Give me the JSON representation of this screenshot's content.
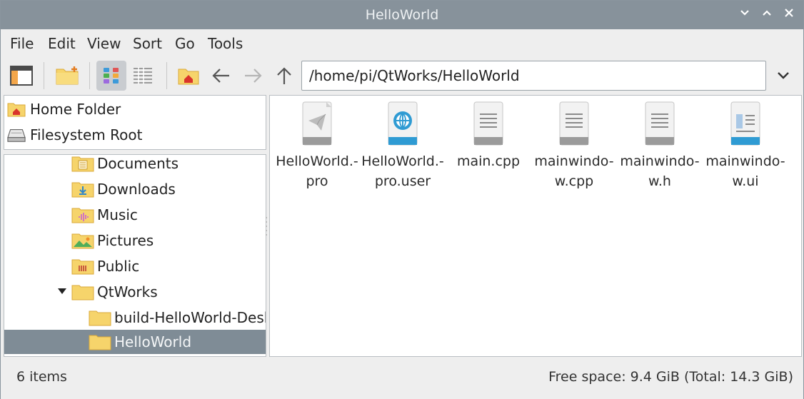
{
  "window": {
    "title": "HelloWorld"
  },
  "window_controls": {
    "minimize": "⌄",
    "maximize": "⌃",
    "close": "✕"
  },
  "menu": [
    "File",
    "Edit",
    "View",
    "Sort",
    "Go",
    "Tools"
  ],
  "toolbar": {
    "buttons": [
      "sidebar-toggle-icon",
      "new-folder-icon",
      "icon-view-icon",
      "list-view-icon",
      "home-icon",
      "back-arrow-icon",
      "forward-arrow-icon",
      "up-arrow-icon",
      "chevron-down-icon"
    ],
    "address": "/home/pi/QtWorks/HelloWorld"
  },
  "places": [
    {
      "label": "Home Folder",
      "icon": "home-folder-icon"
    },
    {
      "label": "Filesystem Root",
      "icon": "drive-icon"
    }
  ],
  "tree": [
    {
      "label": "Documents",
      "icon": "documents-folder-icon"
    },
    {
      "label": "Downloads",
      "icon": "downloads-folder-icon"
    },
    {
      "label": "Music",
      "icon": "music-folder-icon"
    },
    {
      "label": "Pictures",
      "icon": "pictures-folder-icon"
    },
    {
      "label": "Public",
      "icon": "public-folder-icon"
    },
    {
      "label": "QtWorks",
      "icon": "folder-icon",
      "expanded": true
    },
    {
      "label": "build-HelloWorld-Desktop",
      "icon": "folder-icon"
    },
    {
      "label": "HelloWorld",
      "icon": "folder-icon",
      "selected": true
    }
  ],
  "files": [
    {
      "name": "HelloWorld.-pro",
      "icon": "qt-project-file-icon"
    },
    {
      "name": "HelloWorld.-pro.user",
      "icon": "xml-file-icon"
    },
    {
      "name": "main.cpp",
      "icon": "text-file-icon"
    },
    {
      "name": "mainwindo-w.cpp",
      "icon": "text-file-icon"
    },
    {
      "name": "mainwindo-w.h",
      "icon": "text-file-icon"
    },
    {
      "name": "mainwindo-w.ui",
      "icon": "ui-file-icon"
    }
  ],
  "status": {
    "items": "6 items",
    "free_space": "Free space: 9.4 GiB (Total: 14.3 GiB)"
  },
  "colors": {
    "titlebar": "#87929b",
    "selection": "#7f8c96",
    "folder": "#f6d46b",
    "accent_blue": "#2f9bd3"
  }
}
